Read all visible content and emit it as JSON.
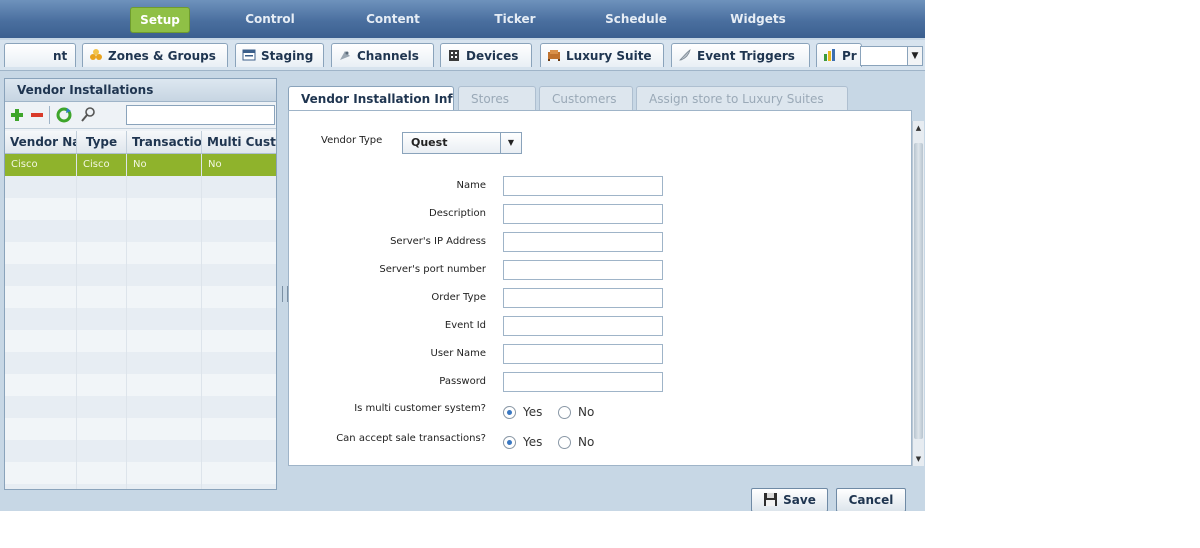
{
  "top_nav": {
    "items": [
      {
        "label": "Setup",
        "active": true
      },
      {
        "label": "Control",
        "active": false
      },
      {
        "label": "Content",
        "active": false
      },
      {
        "label": "Ticker",
        "active": false
      },
      {
        "label": "Schedule",
        "active": false
      },
      {
        "label": "Widgets",
        "active": false
      }
    ]
  },
  "tabs": {
    "items": [
      {
        "label": "nt",
        "icon": "partial-icon"
      },
      {
        "label": "Zones & Groups",
        "icon": "people-group-icon"
      },
      {
        "label": "Staging",
        "icon": "window-icon"
      },
      {
        "label": "Channels",
        "icon": "satellite-dish-icon"
      },
      {
        "label": "Devices",
        "icon": "building-icon"
      },
      {
        "label": "Luxury Suite",
        "icon": "sofa-icon"
      },
      {
        "label": "Event Triggers",
        "icon": "feather-icon"
      },
      {
        "label": "Pr",
        "icon": "chart-icon"
      }
    ],
    "scroll_glyph": "▼"
  },
  "left_panel": {
    "title": "Vendor Installations",
    "search_value": "",
    "columns": [
      "Vendor Name",
      "Type",
      "Transaction",
      "Multi Customer"
    ],
    "rows": [
      {
        "vendor": "Cisco",
        "type": "Cisco",
        "transaction": "No",
        "multi": "No"
      }
    ]
  },
  "right_panel": {
    "tabs": [
      {
        "label": "Vendor Installation Info",
        "active": true
      },
      {
        "label": "Stores",
        "active": false
      },
      {
        "label": "Customers",
        "active": false
      },
      {
        "label": "Assign store to Luxury Suites",
        "active": false
      }
    ],
    "vendor_type": {
      "label": "Vendor Type",
      "value": "Quest",
      "arrow": "▼"
    },
    "fields": [
      {
        "label": "Name",
        "value": ""
      },
      {
        "label": "Description",
        "value": ""
      },
      {
        "label": "Server's IP Address",
        "value": ""
      },
      {
        "label": "Server's port number",
        "value": ""
      },
      {
        "label": "Order Type",
        "value": ""
      },
      {
        "label": "Event Id",
        "value": ""
      },
      {
        "label": "User Name",
        "value": ""
      },
      {
        "label": "Password",
        "value": ""
      }
    ],
    "multi_customer": {
      "label": "Is multi customer system?",
      "yes": "Yes",
      "no": "No",
      "selected": "Yes"
    },
    "sale_transactions": {
      "label": "Can accept sale transactions?",
      "yes": "Yes",
      "no": "No",
      "selected": "Yes"
    }
  },
  "actions": {
    "save": "Save",
    "cancel": "Cancel"
  }
}
